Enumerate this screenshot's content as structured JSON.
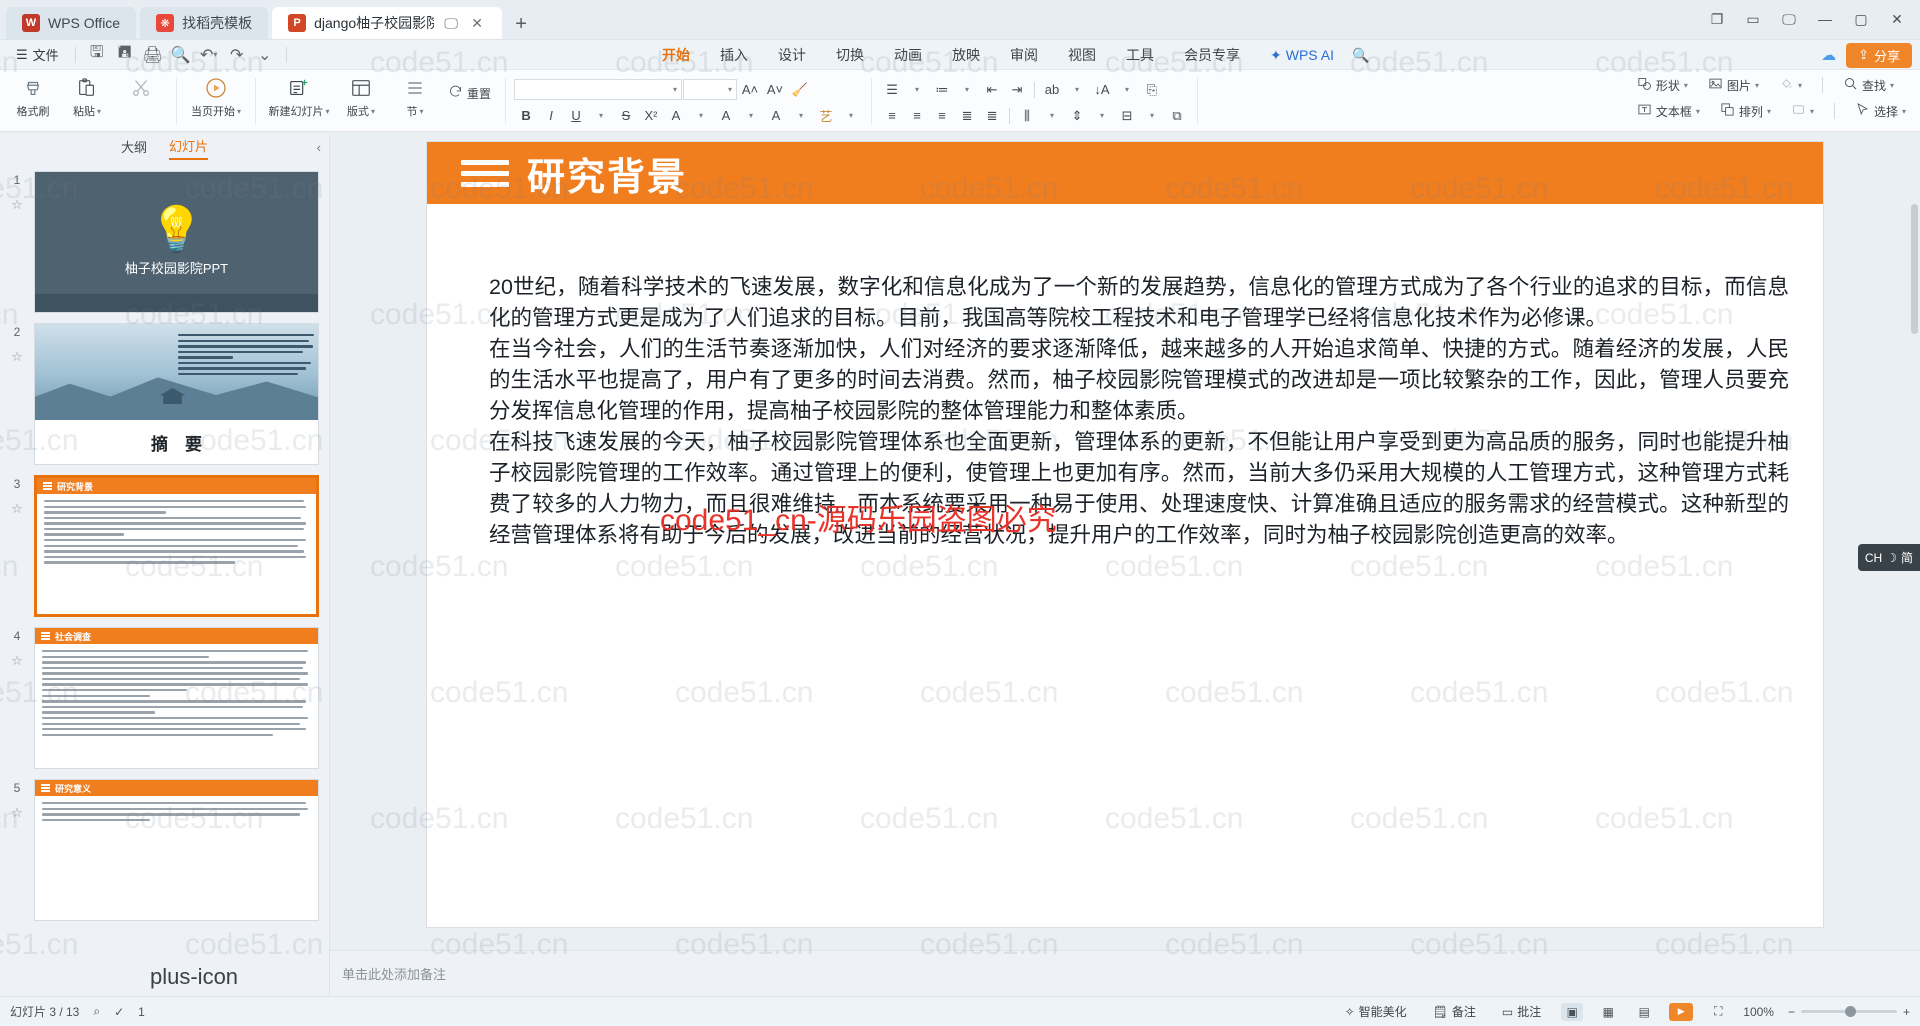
{
  "window": {
    "tabs": [
      {
        "label": "WPS Office",
        "icon": "wps-logo-icon",
        "icon_color": "#c0392b",
        "active": false,
        "closable": false
      },
      {
        "label": "找稻壳模板",
        "icon": "docer-icon",
        "icon_color": "#e8483a",
        "active": false,
        "closable": false
      },
      {
        "label": "django柚子校园影院PPT.pp",
        "icon": "ppt-file-icon",
        "icon_color": "#d24726",
        "active": true,
        "closable": true
      }
    ],
    "new_tab_label": "+",
    "controls": [
      "restore-icon",
      "window-icon",
      "screen-icon",
      "minimize-icon",
      "maximize-icon",
      "close-icon"
    ]
  },
  "menubar": {
    "file_label": "文件",
    "quick_access": [
      "save-icon",
      "save-as-icon",
      "print-icon",
      "print-preview-icon",
      "undo-icon",
      "redo-icon",
      "customize-icon"
    ],
    "ribbon_tabs": [
      {
        "label": "开始",
        "active": true
      },
      {
        "label": "插入",
        "active": false
      },
      {
        "label": "设计",
        "active": false
      },
      {
        "label": "切换",
        "active": false
      },
      {
        "label": "动画",
        "active": false
      },
      {
        "label": "放映",
        "active": false
      },
      {
        "label": "审阅",
        "active": false
      },
      {
        "label": "视图",
        "active": false
      },
      {
        "label": "工具",
        "active": false
      },
      {
        "label": "会员专享",
        "active": false
      }
    ],
    "wps_ai_label": "WPS AI",
    "search_icon": "search-icon",
    "cloud_icon": "cloud-sync-icon",
    "share_label": "分享"
  },
  "ribbon": {
    "clipboard": [
      {
        "label": "格式刷",
        "icon": "format-painter-icon",
        "has_caret": false
      },
      {
        "label": "粘贴",
        "icon": "paste-icon",
        "has_caret": true
      },
      {
        "label": "",
        "icon": "cut-icon",
        "has_caret": false
      }
    ],
    "present": [
      {
        "label": "当页开始",
        "icon": "play-circle-icon",
        "has_caret": true
      }
    ],
    "slides": [
      {
        "label": "新建幻灯片",
        "icon": "new-slide-icon",
        "has_caret": true
      },
      {
        "label": "版式",
        "icon": "layout-icon",
        "has_caret": true
      },
      {
        "label": "节",
        "icon": "section-icon",
        "has_caret": true
      },
      {
        "label": "重置",
        "icon": "reset-icon",
        "has_caret": false
      }
    ],
    "font": {
      "font_family_value": "",
      "font_family_placeholder": "",
      "font_size_value": "",
      "grow_font": "A˄",
      "shrink_font": "A˅",
      "clear_format_icon": "clear-format-icon",
      "buttons": [
        {
          "icon": "bold-icon",
          "label": "B"
        },
        {
          "icon": "italic-icon",
          "label": "I"
        },
        {
          "icon": "underline-icon",
          "label": "U"
        },
        {
          "icon": "strikethrough-icon",
          "label": "S"
        },
        {
          "icon": "superscript-icon",
          "label": "X²"
        },
        {
          "icon": "char-border-icon",
          "label": "A"
        },
        {
          "icon": "text-highlight-icon",
          "label": "A"
        },
        {
          "icon": "font-color-icon",
          "label": "A"
        },
        {
          "icon": "text-effect-icon",
          "label": "艺"
        }
      ]
    },
    "paragraph": {
      "buttons": [
        {
          "icon": "bullets-icon"
        },
        {
          "icon": "numbering-icon"
        },
        {
          "icon": "decrease-indent-icon"
        },
        {
          "icon": "increase-indent-icon"
        },
        {
          "icon": "line-spacing-icon"
        },
        {
          "icon": "sort-icon"
        },
        {
          "icon": "smartart-icon"
        },
        {
          "icon": "align-left-icon"
        },
        {
          "icon": "align-center-icon"
        },
        {
          "icon": "align-right-icon"
        },
        {
          "icon": "justify-icon"
        },
        {
          "icon": "distribute-icon"
        },
        {
          "icon": "columns-icon"
        },
        {
          "icon": "text-direction-icon"
        },
        {
          "icon": "align-text-icon"
        },
        {
          "icon": "convert-smartart-icon"
        }
      ]
    },
    "drawing": [
      {
        "label": "形状",
        "icon": "shapes-icon",
        "has_caret": true
      },
      {
        "label": "图片",
        "icon": "picture-icon",
        "has_caret": true
      },
      {
        "label": "",
        "icon": "fill-icon",
        "has_caret": true
      },
      {
        "label": "文本框",
        "icon": "textbox-icon",
        "has_caret": true
      },
      {
        "label": "排列",
        "icon": "arrange-icon",
        "has_caret": true
      },
      {
        "label": "",
        "icon": "shape-style-icon",
        "has_caret": true
      }
    ],
    "editing": [
      {
        "label": "查找",
        "icon": "search-icon",
        "has_caret": true
      },
      {
        "label": "选择",
        "icon": "select-icon",
        "has_caret": true
      }
    ]
  },
  "thumbnails": {
    "tabs": [
      {
        "label": "大纲",
        "active": false
      },
      {
        "label": "幻灯片",
        "active": true
      }
    ],
    "collapse_icon": "chevron-left-icon",
    "add_slide_icon": "plus-icon",
    "slides": [
      {
        "number": "1",
        "kind": "title",
        "title": "柚子校园影院PPT",
        "selected": false
      },
      {
        "number": "2",
        "kind": "image-summary",
        "title": "摘　要",
        "selected": false
      },
      {
        "number": "3",
        "kind": "orange-text",
        "title": "研究背景",
        "selected": true
      },
      {
        "number": "4",
        "kind": "orange-text",
        "title": "社会调查",
        "selected": false
      },
      {
        "number": "5",
        "kind": "orange-text",
        "title": "研究意义",
        "selected": false
      }
    ]
  },
  "slide": {
    "header_title": "研究背景",
    "header_color": "#f07d1e",
    "menu_icon": "hamburger-icon",
    "paragraphs": [
      "20世纪，随着科学技术的飞速发展，数字化和信息化成为了一个新的发展趋势，信息化的管理方式成为了各个行业的追求的目标，而信息化的管理方式更是成为了人们追求的目标。目前，我国高等院校工程技术和电子管理学已经将信息化技术作为必修课。",
      "在当今社会，人们的生活节奏逐渐加快，人们对经济的要求逐渐降低，越来越多的人开始追求简单、快捷的方式。随着经济的发展，人民的生活水平也提高了，用户有了更多的时间去消费。然而，柚子校园影院管理模式的改进却是一项比较繁杂的工作，因此，管理人员要充分发挥信息化管理的作用，提高柚子校园影院的整体管理能力和整体素质。",
      "在科技飞速发展的今天，柚子校园影院管理体系也全面更新，管理体系的更新，不但能让用户享受到更为高品质的服务，同时也能提升柚子校园影院管理的工作效率。通过管理上的便利，使管理上也更加有序。然而，当前大多仍采用大规模的人工管理方式，这种管理方式耗费了较多的人力物力，而且很难维持。而本系统要采用一种易于使用、处理速度快、计算准确且适应的服务需求的经营模式。这种新型的经营管理体系将有助于今后的发展，改进当前的经营状况，提升用户的工作效率，同时为柚子校园影院创造更高的效率。"
    ]
  },
  "notes": {
    "placeholder": "单击此处添加备注"
  },
  "floating_badge": {
    "label": "CH",
    "sub": "简",
    "icon": "ime-icon"
  },
  "statusbar": {
    "left": [
      {
        "label": "幻灯片 3 / 13",
        "name": "slide-count"
      },
      {
        "label": "",
        "name": "spellcheck-icon"
      },
      {
        "label": "",
        "name": "language-icon"
      },
      {
        "label": "1",
        "name": "section-count"
      }
    ],
    "right": [
      {
        "label": "智能美化",
        "name": "smart-beautify-button",
        "icon": "magic-icon"
      },
      {
        "label": "备注",
        "name": "notes-button",
        "icon": "notes-icon"
      },
      {
        "label": "批注",
        "name": "comment-button",
        "icon": "comment-icon"
      }
    ],
    "view_buttons": [
      "normal-view-icon",
      "slide-sorter-icon",
      "reading-view-icon"
    ],
    "play_button": "play-icon",
    "fit_button": "fit-slide-icon",
    "zoom_level": "100%",
    "zoom_out": "−",
    "zoom_in": "+"
  },
  "watermark": {
    "tile_text": "code51.cn",
    "red_text": "code51_cn-源码乐园盗图必究",
    "red_color": "#e8332a"
  }
}
